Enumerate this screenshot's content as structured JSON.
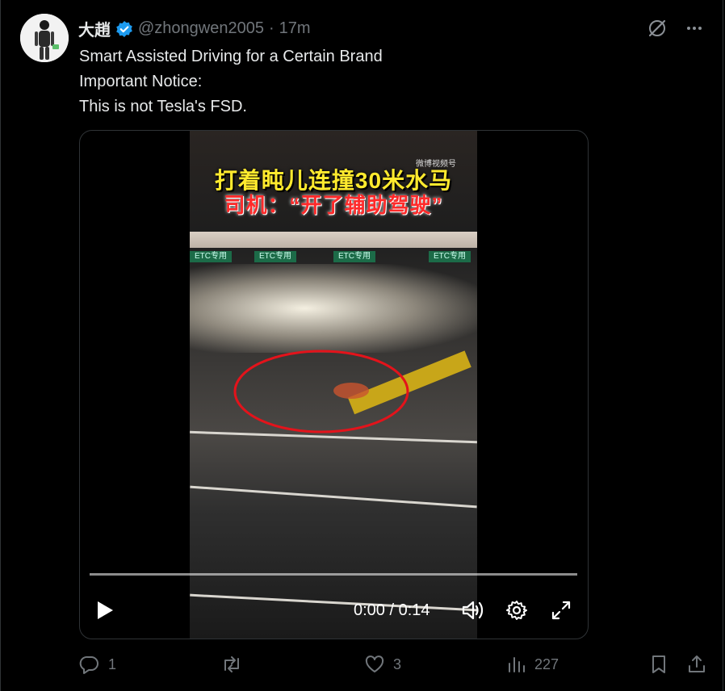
{
  "author": {
    "display_name": "大趙",
    "handle": "@zhongwen2005",
    "separator": "·",
    "time": "17m"
  },
  "post": {
    "lines": [
      "Smart Assisted Driving for a Certain Brand",
      "Important Notice:",
      "This is not Tesla's FSD."
    ]
  },
  "video": {
    "caption_line1": "打着盹儿连撞30米水马",
    "caption_line2": "司机：“开了辅助驾驶”",
    "watermark": "微博视频号",
    "signs": [
      "ETC专用",
      "ETC专用",
      "ETC专用",
      "ETC专用"
    ],
    "timecode": "0:00 / 0:14",
    "progress": 0
  },
  "actions": {
    "replies": "1",
    "reposts": "",
    "likes": "3",
    "views": "227"
  },
  "colors": {
    "verified": "#1d9bf0",
    "muted": "#71767b",
    "highlight_circle": "#e3131b"
  },
  "icons": {
    "verified": "verified-badge-icon",
    "grok": "grok-icon",
    "more": "more-icon",
    "play": "play-icon",
    "volume": "volume-icon",
    "settings": "gear-icon",
    "fullscreen": "fullscreen-icon",
    "reply": "reply-icon",
    "repost": "repost-icon",
    "like": "heart-icon",
    "views": "views-icon",
    "bookmark": "bookmark-icon",
    "share": "share-icon"
  }
}
